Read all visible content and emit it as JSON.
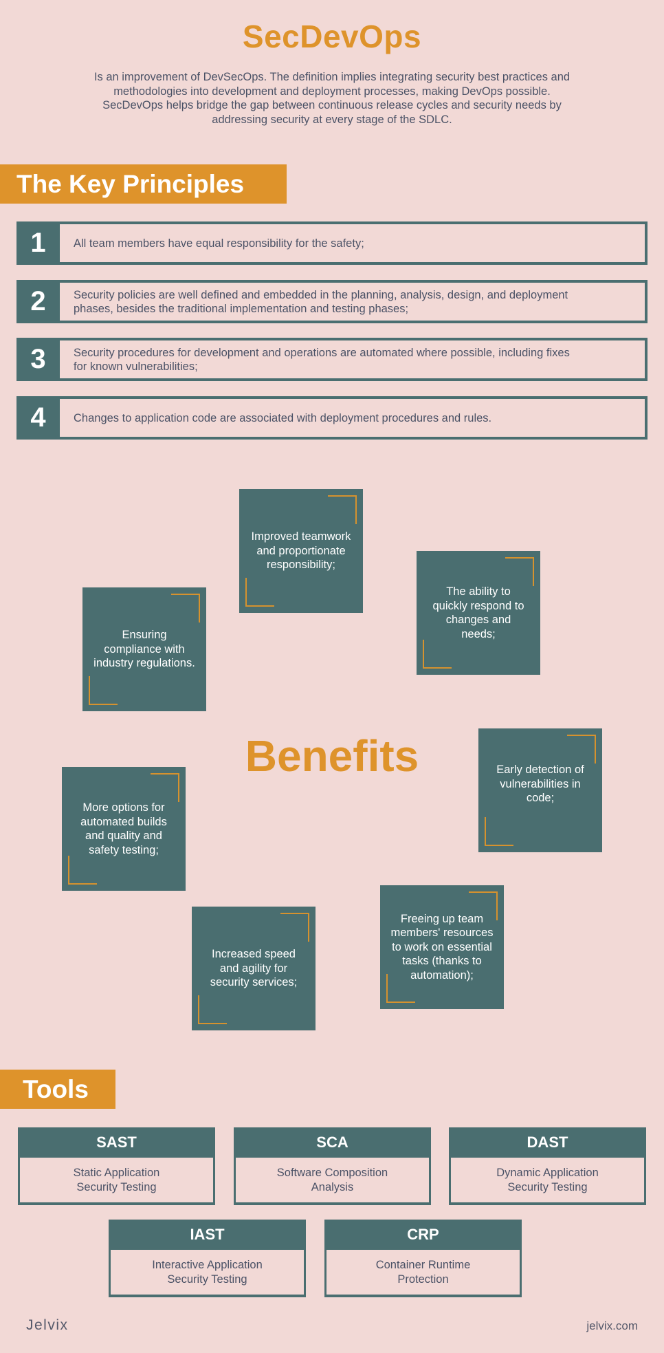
{
  "header": {
    "title": "SecDevOps",
    "intro": "Is an improvement of DevSecOps. The definition implies integrating security best practices and methodologies into development and deployment processes, making DevOps possible. SecDevOps helps bridge the gap between continuous release cycles and security needs by addressing security at every stage of the SDLC."
  },
  "principles": {
    "heading": "The Key Principles",
    "items": [
      {
        "number": "1",
        "text": "All team members have equal responsibility for the safety;"
      },
      {
        "number": "2",
        "text": "Security policies are well defined and embedded in the planning, analysis, design, and deployment phases, besides the traditional implementation and testing phases;"
      },
      {
        "number": "3",
        "text": "Security procedures for development and operations are automated where possible, including fixes for known vulnerabilities;"
      },
      {
        "number": "4",
        "text": "Changes to application code are associated with deployment procedures and rules."
      }
    ]
  },
  "benefits": {
    "heading": "Benefits",
    "items": [
      {
        "text": "Improved teamwork and proportionate responsibility;"
      },
      {
        "text": "The ability to quickly respond to changes and needs;"
      },
      {
        "text": "Ensuring compliance with industry regulations."
      },
      {
        "text": "Early detection of vulnerabilities in code;"
      },
      {
        "text": "More options for automated builds and quality and safety testing;"
      },
      {
        "text": "Freeing up team members' resources to work on essential tasks (thanks to automation);"
      },
      {
        "text": "Increased speed and agility for security services;"
      }
    ]
  },
  "tools": {
    "heading": "Tools",
    "items": [
      {
        "name": "SAST",
        "description": "Static Application Security Testing"
      },
      {
        "name": "SCA",
        "description": "Software Composition Analysis"
      },
      {
        "name": "DAST",
        "description": "Dynamic Application Security Testing"
      },
      {
        "name": "IAST",
        "description": "Interactive Application Security Testing"
      },
      {
        "name": "CRP",
        "description": "Container Runtime Protection"
      }
    ]
  },
  "footer": {
    "logo": "Jelvix",
    "url": "jelvix.com"
  },
  "colors": {
    "background": "#f2d9d6",
    "accent": "#de932b",
    "teal": "#4a6e70",
    "text": "#4b5266"
  }
}
